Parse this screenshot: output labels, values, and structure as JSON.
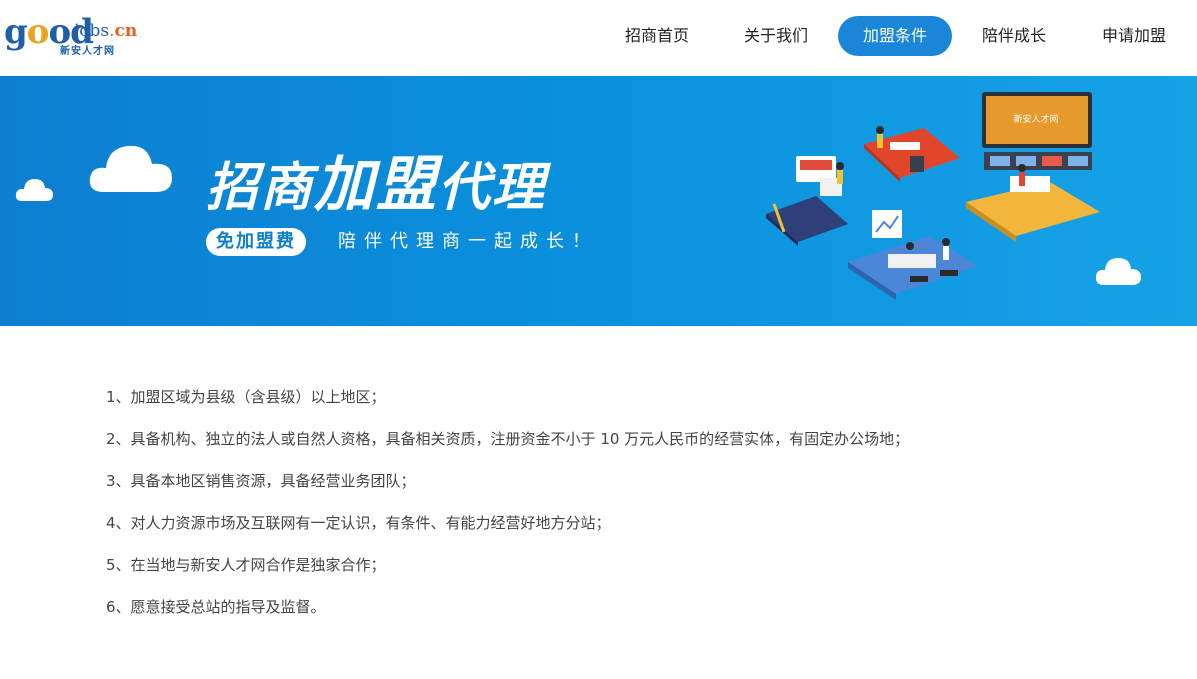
{
  "logo": {
    "good": [
      "g",
      "o",
      "o",
      "d"
    ],
    "jobs": "jobs",
    "dot": ".",
    "cn": "cn",
    "sub": "新安人才网"
  },
  "nav": {
    "items": [
      {
        "label": "招商首页",
        "active": false
      },
      {
        "label": "关于我们",
        "active": false
      },
      {
        "label": "加盟条件",
        "active": true
      },
      {
        "label": "陪伴成长",
        "active": false
      },
      {
        "label": "申请加盟",
        "active": false
      }
    ]
  },
  "banner": {
    "title_small": "招商",
    "title_big": "加盟",
    "title_small2": "代理",
    "pill": "免加盟费",
    "slogan": "陪伴代理商一起成长！",
    "screen_text": "新安人才网",
    "colors": {
      "bg_start": "#0e7fd0",
      "bg_end": "#17a2e6",
      "accent": "#1a86d8"
    }
  },
  "conditions": [
    "1、加盟区域为县级（含县级）以上地区；",
    "2、具备机构、独立的法人或自然人资格，具备相关资质，注册资金不小于 10 万元人民币的经营实体，有固定办公场地；",
    "3、具备本地区销售资源，具备经营业务团队；",
    "4、对人力资源市场及互联网有一定认识，有条件、有能力经营好地方分站；",
    "5、在当地与新安人才网合作是独家合作；",
    "6、愿意接受总站的指导及监督。"
  ]
}
